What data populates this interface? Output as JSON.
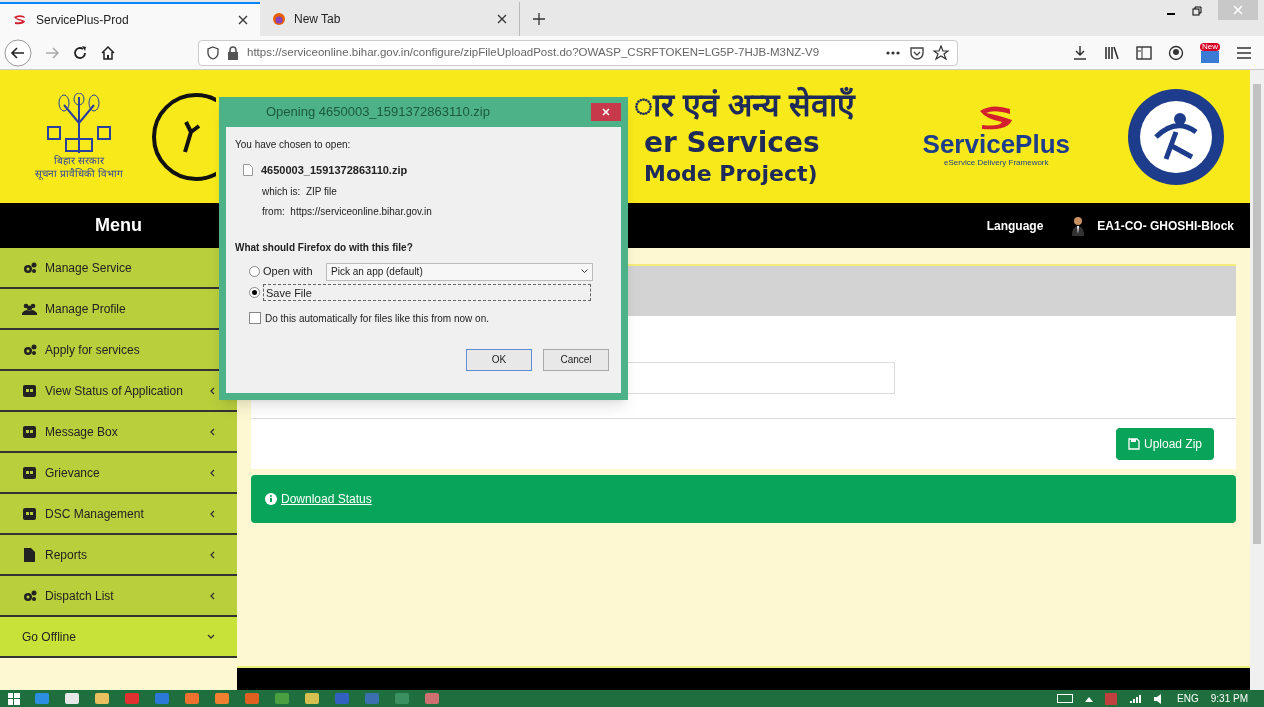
{
  "browser": {
    "tabs": [
      {
        "label": "ServicePlus-Prod",
        "selected": true
      },
      {
        "label": "New Tab",
        "selected": false
      }
    ],
    "url": "https://serviceonline.bihar.gov.in/configure/zipFileUploadPost.do?OWASP_CSRFTOKEN=LG5P-7HJB-M3NZ-V9",
    "new_badge": "New"
  },
  "banner": {
    "dept_line1": "बिहार सरकार",
    "dept_line2": "सूचना प्रावैधिकी विभाग",
    "title_hindi": "ार एवं अन्य सेवाएँ",
    "title_en_1": "er Services",
    "title_en_2": "Mode Project)",
    "brand": "ServicePlus",
    "brand_tagline": "eService Delivery Framework"
  },
  "navbar": {
    "menu_title": "Menu",
    "language": "Language",
    "user": "EA1-CO- GHOSHI-Block"
  },
  "sidebar": {
    "items": [
      {
        "label": "Manage Service",
        "kind": "gears",
        "has_caret": false,
        "expanded": false
      },
      {
        "label": "Manage Profile",
        "kind": "users",
        "has_caret": false,
        "expanded": false
      },
      {
        "label": "Apply for services",
        "kind": "gears",
        "has_caret": false,
        "expanded": false
      },
      {
        "label": "View Status of Application",
        "kind": "box",
        "has_caret": true,
        "expanded": false
      },
      {
        "label": "Message Box",
        "kind": "box",
        "has_caret": true,
        "expanded": false
      },
      {
        "label": "Grievance",
        "kind": "box",
        "has_caret": true,
        "expanded": false
      },
      {
        "label": "DSC Management",
        "kind": "box",
        "has_caret": true,
        "expanded": false
      },
      {
        "label": "Reports",
        "kind": "file",
        "has_caret": true,
        "expanded": false
      },
      {
        "label": "Dispatch List",
        "kind": "gears",
        "has_caret": true,
        "expanded": false
      },
      {
        "label": "Go Offline",
        "kind": "plain",
        "has_caret": true,
        "expanded": true
      }
    ]
  },
  "main": {
    "upload_button": "Upload Zip",
    "status_link": "Download Status"
  },
  "dialog": {
    "title": "Opening 4650003_1591372863110.zip",
    "intro": "You have chosen to open:",
    "filename": "4650003_1591372863110.zip",
    "which_is": "which is:  ZIP file",
    "from": "from:  https://serviceonline.bihar.gov.in",
    "question": "What should Firefox do with this file?",
    "options": [
      {
        "label": "Open with",
        "selected": false
      },
      {
        "label": "Save File",
        "selected": true
      }
    ],
    "app_select": "Pick an app (default)",
    "auto": {
      "label": "Do this automatically for files like this from now on.",
      "checked": false
    },
    "buttons": [
      "OK",
      "Cancel"
    ]
  },
  "taskbar": {
    "language": "ENG",
    "clock": "9:31 PM"
  }
}
